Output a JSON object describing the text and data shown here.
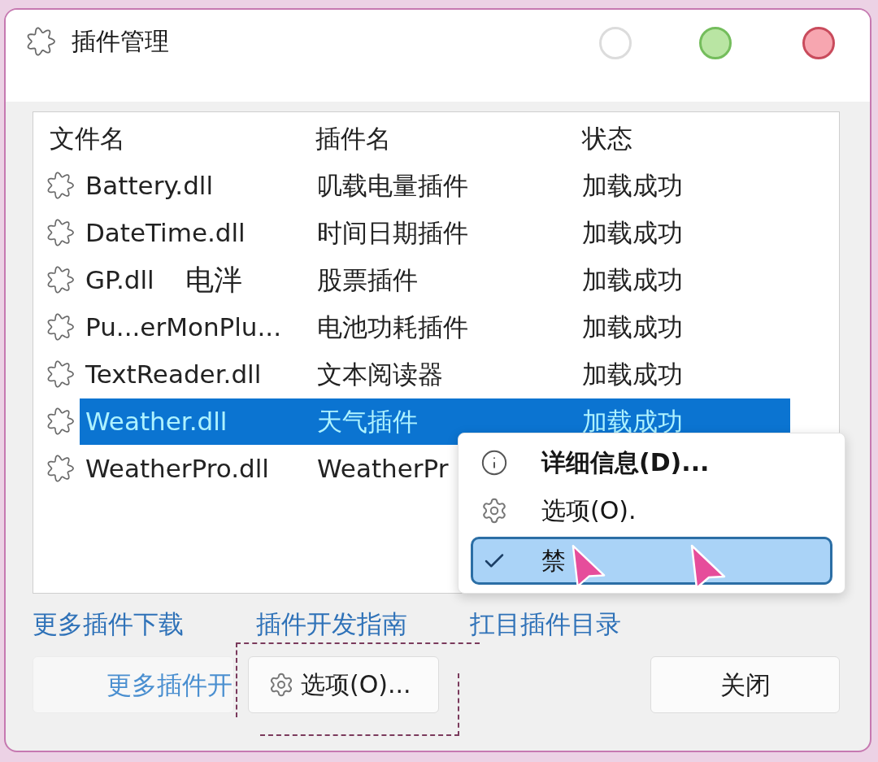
{
  "window": {
    "title": "插件管理"
  },
  "table": {
    "columns": [
      "文件名",
      "插件名",
      "状态"
    ],
    "rows": [
      {
        "file": "Battery.dll",
        "plugin": "叽载电量插件",
        "status": "加载成功",
        "selected": false
      },
      {
        "file": "DateTime.dll",
        "plugin": "时间日期插件",
        "status": "加载成功",
        "selected": false
      },
      {
        "file": "GP.dll",
        "stray_text": "电泮",
        "plugin": "股票插件",
        "status": "加载成功",
        "selected": false
      },
      {
        "file": "Pu...erMonPlu...",
        "plugin": "电池功耗插件",
        "status": "加载成功",
        "selected": false
      },
      {
        "file": "TextReader.dll",
        "plugin": "文本阅读器",
        "status": "加载成功",
        "selected": false
      },
      {
        "file": "Weather.dll",
        "plugin": "天气插件",
        "status": "加载成功",
        "selected": true
      },
      {
        "file": "WeatherPro.dll",
        "plugin": "WeatherPr",
        "selected": false
      }
    ]
  },
  "context_menu": {
    "items": [
      {
        "kind": "info",
        "label": "详细信息(D)...",
        "bold": true,
        "selected": false
      },
      {
        "kind": "gear",
        "label": "选项(O).",
        "bold": false,
        "selected": false
      },
      {
        "kind": "check",
        "label": "禁",
        "bold": false,
        "selected": true
      }
    ]
  },
  "links": [
    "更多插件下载",
    "插件开发指南",
    "扛目插件目录"
  ],
  "buttons": [
    {
      "kind": "faded",
      "label": "更多插件开"
    },
    {
      "kind": "options",
      "label": "选项(O)..."
    },
    {
      "kind": "close",
      "label": "关闭"
    }
  ]
}
